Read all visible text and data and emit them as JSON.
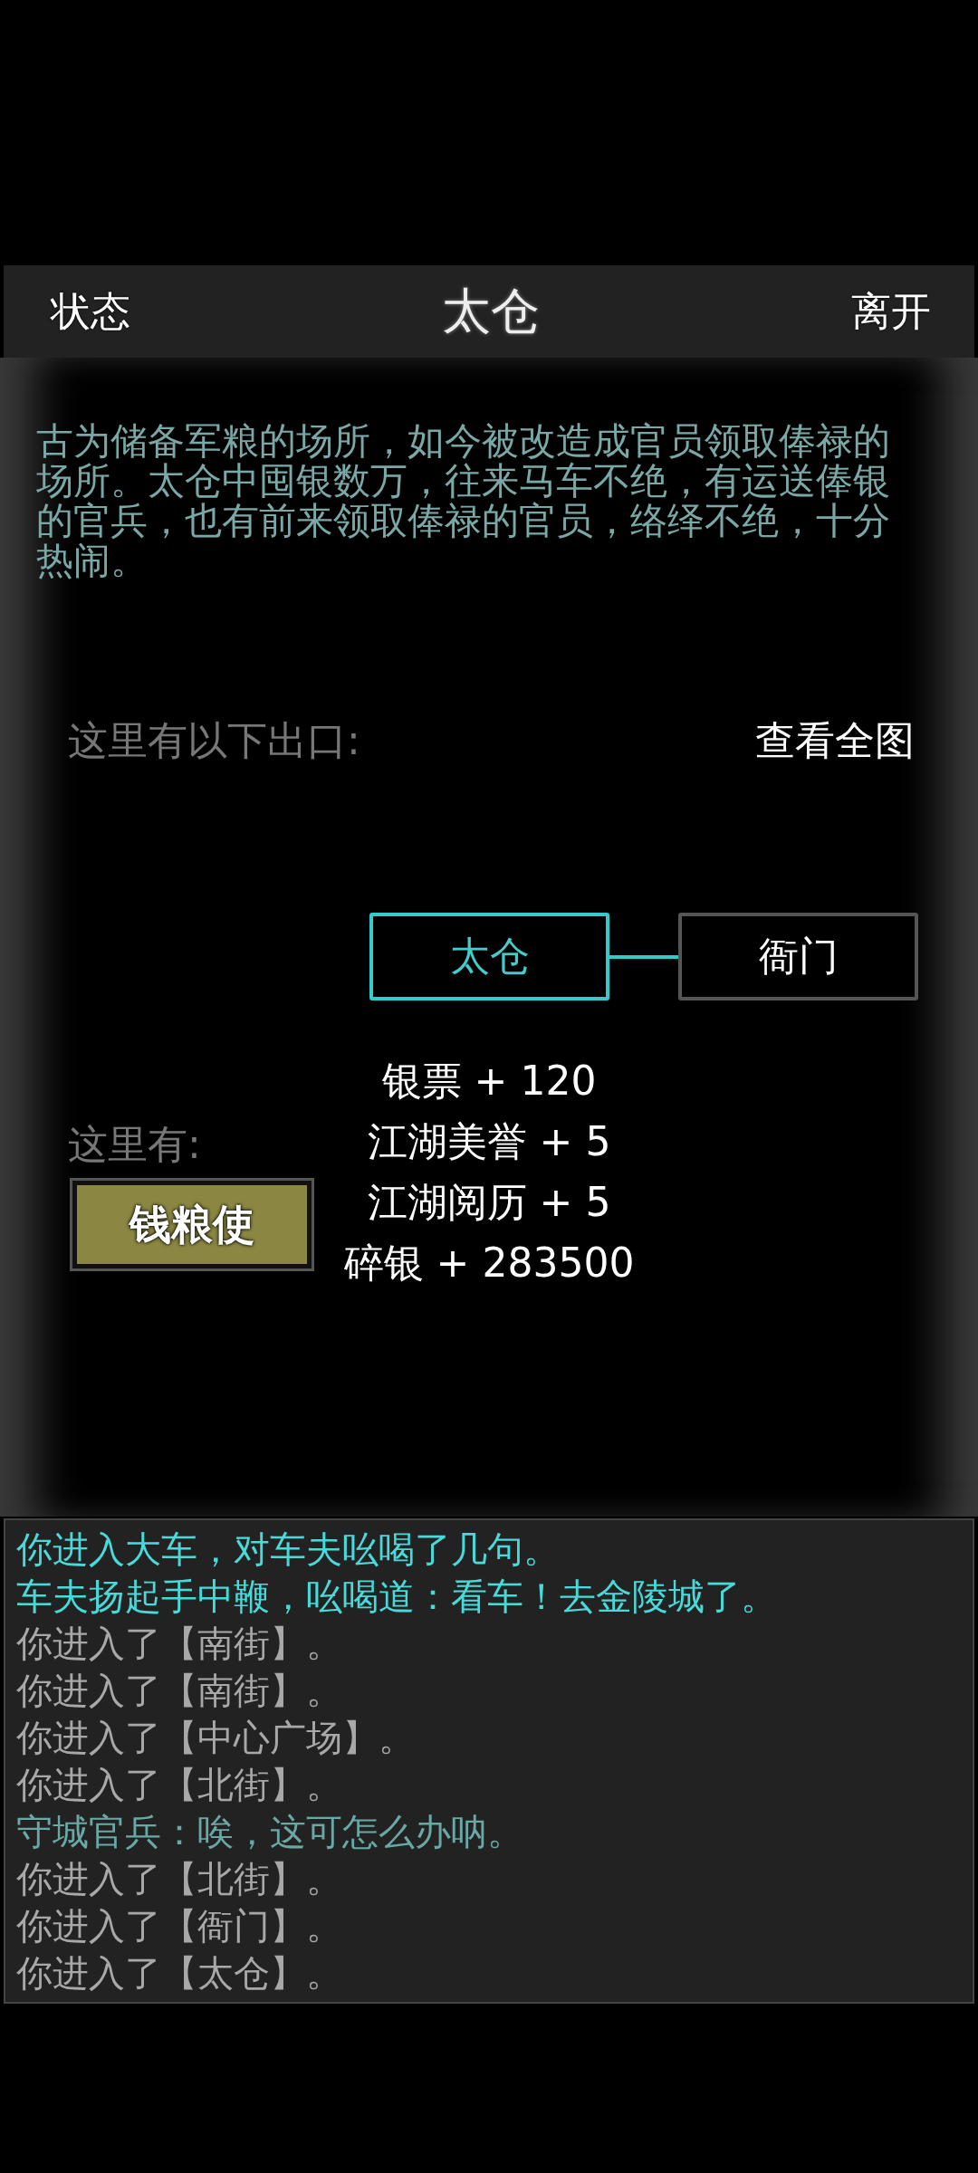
{
  "header": {
    "left": "状态",
    "title": "太仓",
    "right": "离开"
  },
  "description": "古为储备军粮的场所，如今被改造成官员领取俸禄的场所。太仓中囤银数万，往来马车不绝，有运送俸银的官兵，也有前来领取俸禄的官员，络绎不绝，十分热闹。",
  "exits": {
    "label": "这里有以下出口:",
    "map_link": "查看全图"
  },
  "map": {
    "nodes": [
      {
        "label": "太仓",
        "selected": true
      },
      {
        "label": "衙门",
        "selected": false
      }
    ]
  },
  "rewards": [
    "银票 + 120",
    "江湖美誉 + 5",
    "江湖阅历 + 5",
    "碎银 + 283500"
  ],
  "here": {
    "label": "这里有:",
    "npcs": [
      "钱粮使"
    ]
  },
  "log": [
    {
      "kind": "narration",
      "text": "你进入大车，对车夫吆喝了几句。"
    },
    {
      "kind": "narration",
      "text": "车夫扬起手中鞭，吆喝道：看车！去金陵城了。"
    },
    {
      "kind": "move",
      "text": "你进入了【南街】。"
    },
    {
      "kind": "move",
      "text": "你进入了【南街】。"
    },
    {
      "kind": "move",
      "text": "你进入了【中心广场】。"
    },
    {
      "kind": "move",
      "text": "你进入了【北街】。"
    },
    {
      "kind": "speech",
      "text": "守城官兵：唉，这可怎么办呐。"
    },
    {
      "kind": "move",
      "text": "你进入了【北街】。"
    },
    {
      "kind": "move",
      "text": "你进入了【衙门】。"
    },
    {
      "kind": "move",
      "text": "你进入了【太仓】。"
    }
  ]
}
